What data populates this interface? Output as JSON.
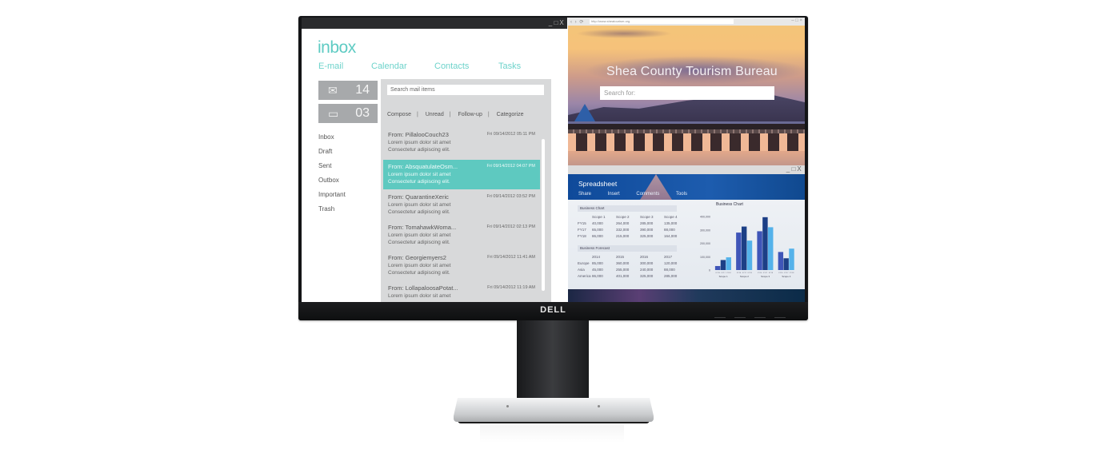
{
  "brand": {
    "logo": "DELL"
  },
  "mail": {
    "title": "inbox",
    "window_controls": [
      "_",
      "□",
      "X"
    ],
    "tabs": [
      "E-mail",
      "Calendar",
      "Contacts",
      "Tasks"
    ],
    "counters": [
      {
        "icon": "envelope-icon",
        "glyph": "✉",
        "value": "14"
      },
      {
        "icon": "chat-bubble-icon",
        "glyph": "▭",
        "value": "03"
      }
    ],
    "folders": [
      "Inbox",
      "Draft",
      "Sent",
      "Outbox",
      "Important",
      "Trash"
    ],
    "search_placeholder": "Search mail items",
    "actions": [
      "Compose",
      "Unread",
      "Follow-up",
      "Categorize"
    ],
    "messages": [
      {
        "from": "From: PillalooCouch23",
        "date": "Fri 09/14/2012 05:11 PM",
        "line1": "Lorem ipsum dolor sit amet",
        "line2": "Consectetur adipiscing elit.",
        "selected": false
      },
      {
        "from": "From: AbsquatulateOsm...",
        "date": "Fri 09/14/2012 04:07 PM",
        "line1": "Lorem ipsum dolor sit amet",
        "line2": "Consectetur adipiscing elit.",
        "selected": true
      },
      {
        "from": "From: QuarantineXeric",
        "date": "Fri 09/14/2012 03:52 PM",
        "line1": "Lorem ipsum dolor sit amet",
        "line2": "Consectetur adipiscing elit.",
        "selected": false
      },
      {
        "from": "From: TomahawkWoma...",
        "date": "Fri 09/14/2012 02:13 PM",
        "line1": "Lorem ipsum dolor sit amet",
        "line2": "Consectetur adipiscing elit.",
        "selected": false
      },
      {
        "from": "From: Georgiemyers2",
        "date": "Fri 09/14/2012 11:41 AM",
        "line1": "Lorem ipsum dolor sit amet",
        "line2": "Consectetur adipiscing elit.",
        "selected": false
      },
      {
        "from": "From: LollapaloosaPotat...",
        "date": "Fri 09/14/2012 11:19 AM",
        "line1": "Lorem ipsum dolor sit amet",
        "line2": "",
        "selected": false
      }
    ]
  },
  "browser": {
    "nav": "‹ › ⟳",
    "address": "http://www.sheatourism.org",
    "controls": "– □ ×",
    "heading": "Shea County Tourism Bureau",
    "search_placeholder": "Search for:"
  },
  "spreadsheet": {
    "title": "Spreadsheet",
    "window_controls": [
      "_",
      "□",
      "X"
    ],
    "menu": [
      "Share",
      "Insert",
      "Comments",
      "Tools"
    ],
    "table1": {
      "caption": "Business Chart",
      "headers": [
        "",
        "Scope 1",
        "Scope 2",
        "Scope 3",
        "Scope 4"
      ],
      "rows": [
        [
          "FY15",
          "40,000",
          "264,000",
          "285,000",
          "135,000"
        ],
        [
          "FY17",
          "65,000",
          "332,000",
          "390,000",
          "88,000"
        ],
        [
          "FY18",
          "86,000",
          "215,000",
          "325,000",
          "164,000"
        ]
      ]
    },
    "table2": {
      "caption": "Business Forecast",
      "headers": [
        "",
        "2014",
        "2015",
        "2016",
        "2017"
      ],
      "rows": [
        [
          "Europe",
          "85,000",
          "360,000",
          "300,000",
          "120,000"
        ],
        [
          "Asia",
          "45,000",
          "255,000",
          "240,000",
          "88,000"
        ],
        [
          "America",
          "86,000",
          "401,000",
          "325,000",
          "285,000"
        ]
      ]
    }
  },
  "chart_data": {
    "type": "bar",
    "title": "Business Chart",
    "categories": [
      "Scope 1",
      "Scope 2",
      "Scope 3",
      "Scope 4"
    ],
    "series": [
      {
        "name": "FY16",
        "color": "#3f55b8",
        "values": [
          30000,
          280000,
          290000,
          135000
        ]
      },
      {
        "name": "FY17",
        "color": "#1c3f86",
        "values": [
          75000,
          325000,
          395000,
          88000
        ]
      },
      {
        "name": "FY18",
        "color": "#54b2ea",
        "values": [
          95000,
          220000,
          320000,
          160000
        ]
      }
    ],
    "yticks": [
      "0",
      "100,000",
      "200,000",
      "300,000",
      "400,000"
    ],
    "ylim": [
      0,
      400000
    ],
    "xlabel": "",
    "ylabel": "",
    "legend": "none",
    "grid": false
  }
}
